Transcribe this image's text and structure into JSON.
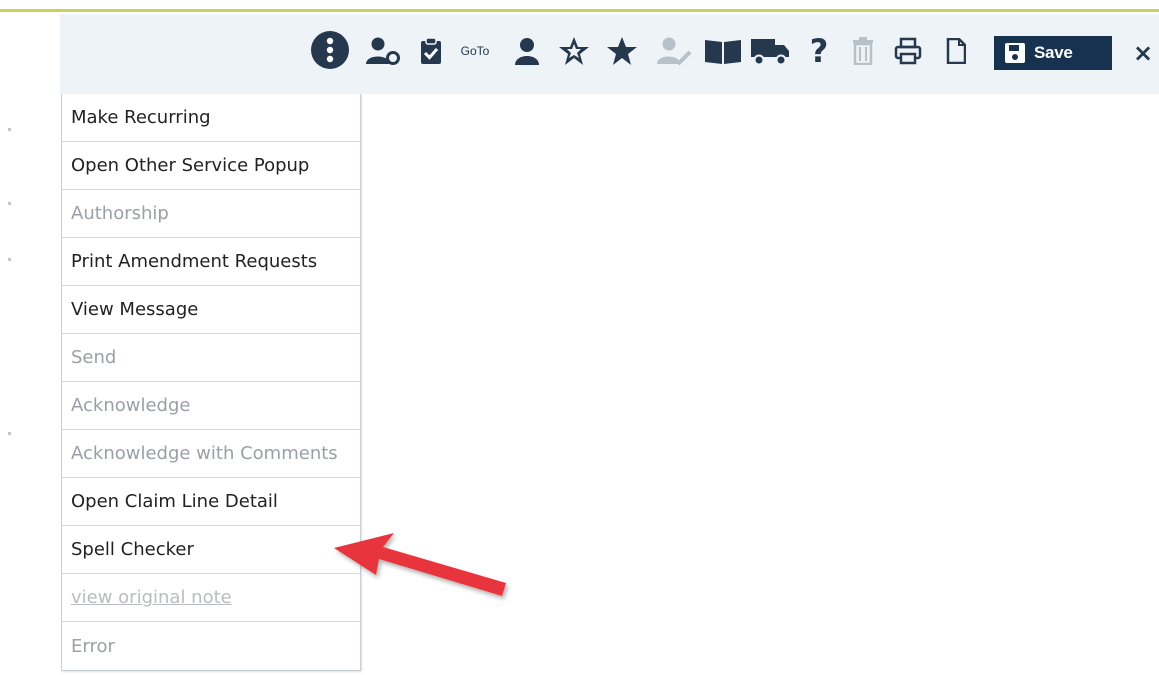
{
  "toolbar": {
    "icons": [
      "more-vertical-icon",
      "user-settings-icon",
      "clipboard-check-icon",
      "goto-icon",
      "user-icon",
      "star-outline-icon",
      "star-icon",
      "user-edit-icon",
      "book-icon",
      "truck-icon",
      "help-icon",
      "trash-icon",
      "print-icon",
      "document-icon"
    ],
    "goto_label": "GoTo",
    "save_label": "Save",
    "close_label": "×",
    "accent_color": "#c6d25a",
    "save_color": "#16324f"
  },
  "menu": {
    "items": [
      {
        "label": "Make Recurring",
        "state": "enabled"
      },
      {
        "label": "Open Other Service Popup",
        "state": "enabled"
      },
      {
        "label": "Authorship",
        "state": "disabled"
      },
      {
        "label": "Print Amendment Requests",
        "state": "enabled"
      },
      {
        "label": "View Message",
        "state": "enabled"
      },
      {
        "label": "Send",
        "state": "disabled"
      },
      {
        "label": "Acknowledge",
        "state": "disabled"
      },
      {
        "label": "Acknowledge with Comments",
        "state": "disabled"
      },
      {
        "label": "Open Claim Line Detail",
        "state": "enabled"
      },
      {
        "label": "Spell Checker",
        "state": "enabled"
      },
      {
        "label": "view original note",
        "state": "disabled-link"
      },
      {
        "label": "Error",
        "state": "disabled"
      }
    ]
  },
  "annotation": {
    "arrow_color": "#e8363c",
    "target": "Spell Checker"
  }
}
